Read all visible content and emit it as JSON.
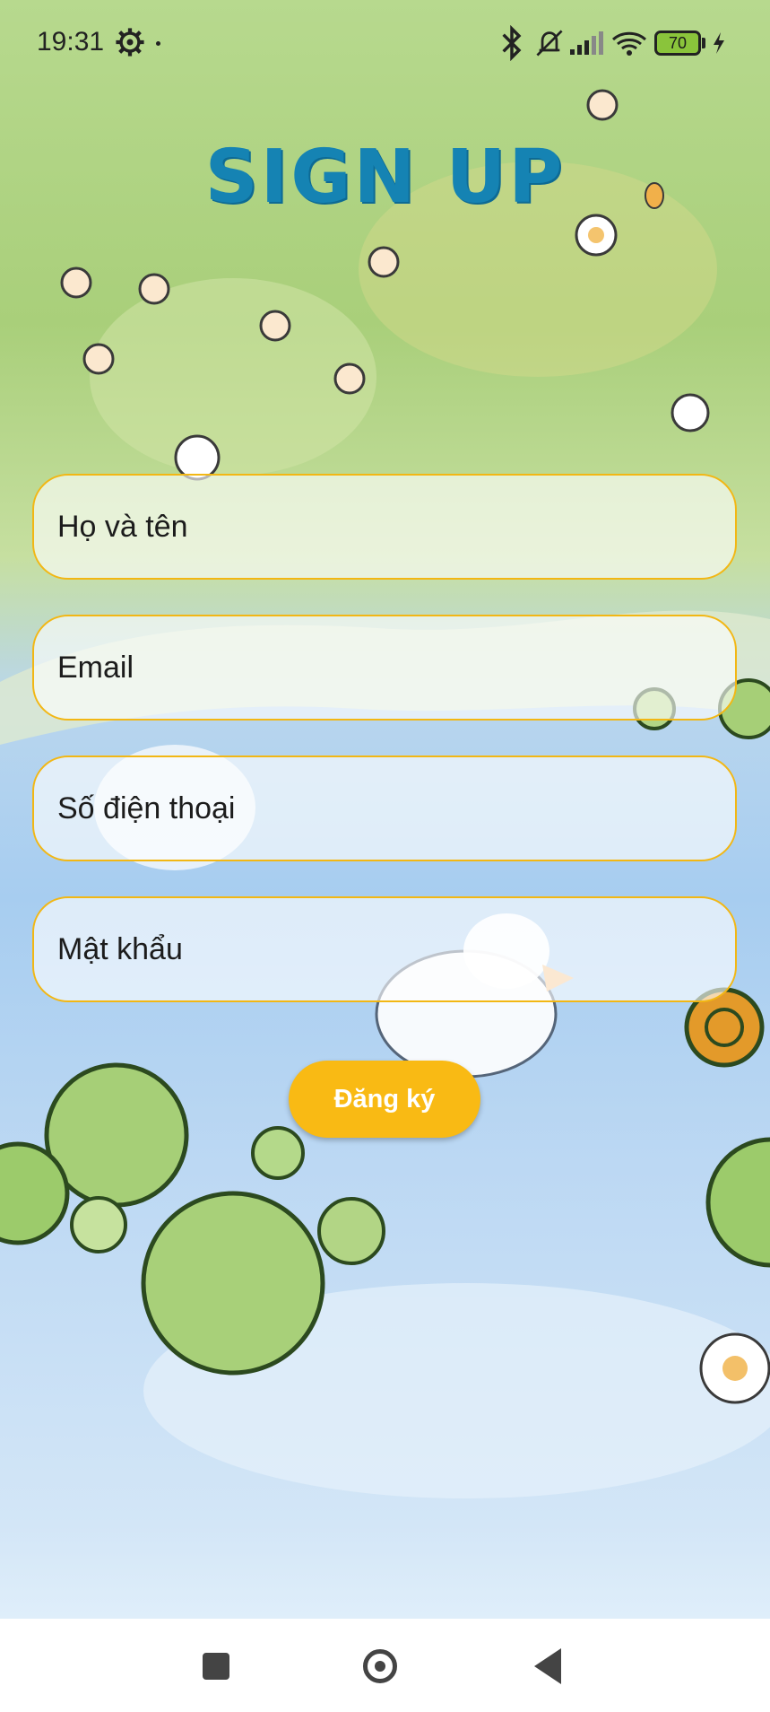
{
  "status_bar": {
    "time": "19:31",
    "battery_level": "70",
    "icons": [
      "gear-icon",
      "bluetooth-icon",
      "bell-muted-icon",
      "signal-icon",
      "wifi-icon",
      "battery-icon",
      "charging-icon"
    ]
  },
  "page": {
    "title": "SIGN UP"
  },
  "form": {
    "full_name_placeholder": "Họ và tên",
    "email_placeholder": "Email",
    "phone_placeholder": "Số điện thoại",
    "password_placeholder": "Mật khẩu",
    "submit_label": "Đăng ký"
  },
  "nav_bar": {
    "icons": [
      "recent-apps-icon",
      "home-icon",
      "back-icon"
    ]
  },
  "colors": {
    "title": "#1583b3",
    "field_border": "#f2b714",
    "button": "#f9ba14"
  }
}
